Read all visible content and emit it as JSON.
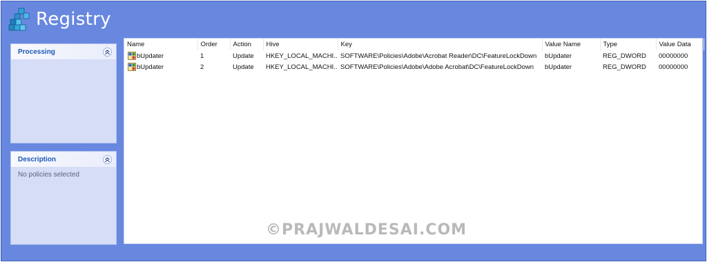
{
  "app": {
    "title": "Registry",
    "icon": "registry-editor-icon"
  },
  "panels": {
    "processing": {
      "title": "Processing",
      "body": ""
    },
    "description": {
      "title": "Description",
      "body": "No policies selected"
    }
  },
  "table": {
    "columns": [
      "Name",
      "Order",
      "Action",
      "Hive",
      "Key",
      "Value Name",
      "Type",
      "Value Data"
    ],
    "rows": [
      {
        "name": "bUpdater",
        "order": "1",
        "action": "Update",
        "hive": "HKEY_LOCAL_MACHI...",
        "key": "SOFTWARE\\Policies\\Adobe\\Acrobat Reader\\DC\\FeatureLockDown",
        "value_name": "bUpdater",
        "type": "REG_DWORD",
        "value_data": "00000000"
      },
      {
        "name": "bUpdater",
        "order": "2",
        "action": "Update",
        "hive": "HKEY_LOCAL_MACHI...",
        "key": "SOFTWARE\\Policies\\Adobe\\Adobe Acrobat\\DC\\FeatureLockDown",
        "value_name": "bUpdater",
        "type": "REG_DWORD",
        "value_data": "00000000"
      }
    ]
  },
  "watermark": "©PRAJWALDESAI.COM",
  "colors": {
    "background": "#6888e0",
    "panel": "#d5ddf7",
    "panel_title": "#1d57b8",
    "content": "#ffffff"
  }
}
